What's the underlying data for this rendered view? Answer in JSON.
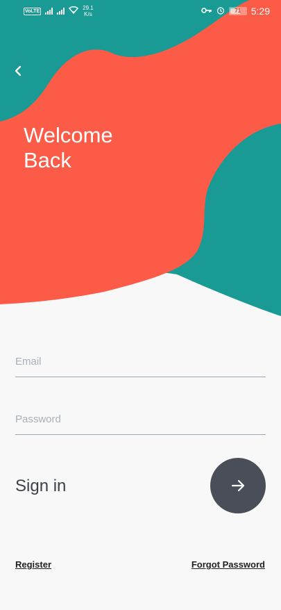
{
  "status_bar": {
    "volte": "VoLTE",
    "network_speed_value": "29.1",
    "network_speed_unit": "K/s",
    "battery_level": "71",
    "time": "5:29",
    "icons": [
      "volte-icon",
      "signal-icon",
      "wifi-icon",
      "key-icon",
      "alarm-icon",
      "battery-icon"
    ]
  },
  "header": {
    "title": "Welcome Back",
    "back_icon": "chevron-left-icon"
  },
  "form": {
    "email_placeholder": "Email",
    "email_value": "",
    "password_placeholder": "Password",
    "password_value": "",
    "signin_label": "Sign in",
    "signin_icon": "arrow-right-icon"
  },
  "footer": {
    "register_label": "Register",
    "forgot_password_label": "Forgot Password"
  },
  "colors": {
    "teal": "#1a9a94",
    "coral": "#fc5c47",
    "background": "#f8f8f8",
    "button": "#4a4e58"
  }
}
